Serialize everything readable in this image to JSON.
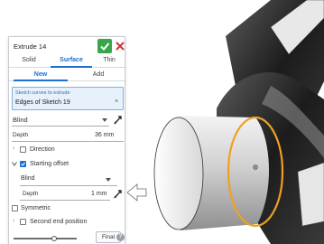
{
  "feature": {
    "title": "Extrude 14",
    "confirm_icon": "check-icon",
    "cancel_icon": "close-icon"
  },
  "creation_tabs": [
    {
      "label": "Solid",
      "active": false
    },
    {
      "label": "Surface",
      "active": true
    },
    {
      "label": "Thin",
      "active": false
    }
  ],
  "mode_tabs": [
    {
      "label": "New",
      "active": true
    },
    {
      "label": "Add",
      "active": false
    }
  ],
  "selection": {
    "label": "Sketch curves to extrude",
    "value": "Edges of Sketch 19",
    "clear": "×"
  },
  "end_type": {
    "value": "Blind",
    "flip_icon": "flip-direction-icon"
  },
  "depth": {
    "label": "Depth",
    "value": "36 mm"
  },
  "direction": {
    "label": "Direction",
    "checked": false
  },
  "starting_offset": {
    "label": "Starting offset",
    "checked": true,
    "type_value": "Blind",
    "depth_label": "Depth",
    "depth_value": "1 mm"
  },
  "symmetric": {
    "label": "Symmetric",
    "checked": false
  },
  "second_end": {
    "label": "Second end position",
    "checked": false
  },
  "footer": {
    "final_label": "Final",
    "help_icon": "help-icon",
    "help_text": "?"
  },
  "colors": {
    "accent": "#1d6fd1",
    "confirm": "#3aa64a",
    "cancel": "#d32f2f",
    "highlight_edge": "#f0a020",
    "selection_bg": "#e6f1fb"
  }
}
